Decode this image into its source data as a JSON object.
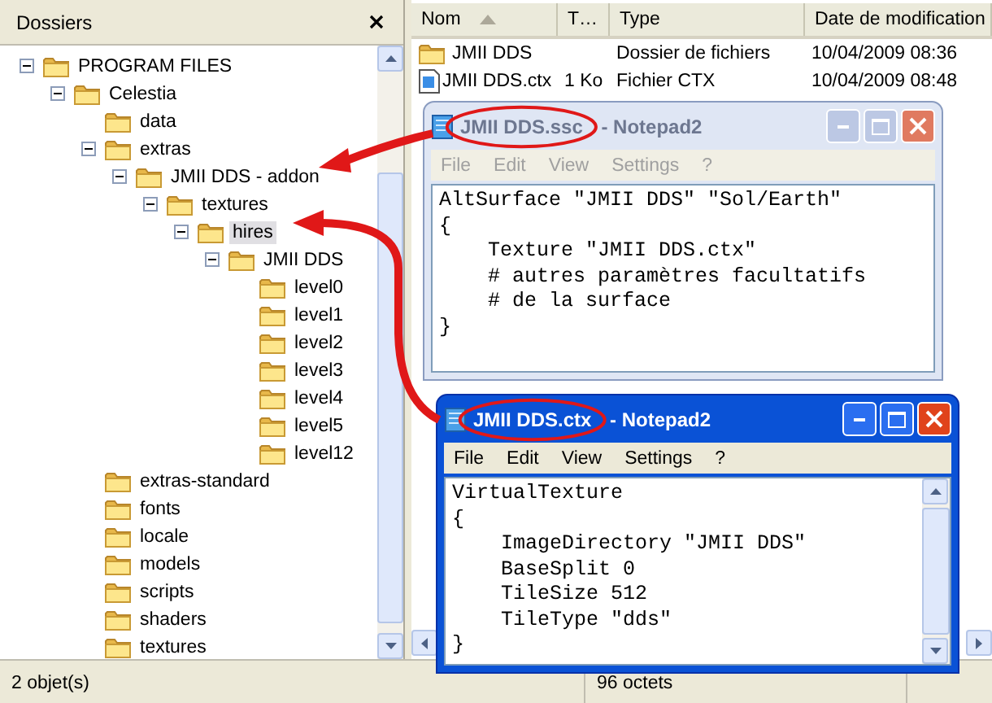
{
  "folders_pane": {
    "title": "Dossiers",
    "tree": [
      {
        "label": "PROGRAM FILES",
        "expanded": true,
        "selected": false,
        "children": [
          {
            "label": "Celestia",
            "expanded": true,
            "selected": false,
            "children": [
              {
                "label": "data",
                "expanded": false,
                "selected": false
              },
              {
                "label": "extras",
                "expanded": true,
                "selected": false,
                "children": [
                  {
                    "label": "JMII DDS - addon",
                    "expanded": true,
                    "selected": false,
                    "children": [
                      {
                        "label": "textures",
                        "expanded": true,
                        "selected": false,
                        "children": [
                          {
                            "label": "hires",
                            "expanded": true,
                            "selected": true,
                            "children": [
                              {
                                "label": "JMII DDS",
                                "expanded": true,
                                "selected": false,
                                "children": [
                                  {
                                    "label": "level0",
                                    "expanded": false,
                                    "selected": false
                                  },
                                  {
                                    "label": "level1",
                                    "expanded": false,
                                    "selected": false
                                  },
                                  {
                                    "label": "level2",
                                    "expanded": false,
                                    "selected": false
                                  },
                                  {
                                    "label": "level3",
                                    "expanded": false,
                                    "selected": false
                                  },
                                  {
                                    "label": "level4",
                                    "expanded": false,
                                    "selected": false
                                  },
                                  {
                                    "label": "level5",
                                    "expanded": false,
                                    "selected": false
                                  },
                                  {
                                    "label": "level12",
                                    "expanded": false,
                                    "selected": false
                                  }
                                ]
                              }
                            ]
                          }
                        ]
                      }
                    ]
                  }
                ]
              },
              {
                "label": "extras-standard",
                "expanded": false,
                "selected": false
              },
              {
                "label": "fonts",
                "expanded": false,
                "selected": false
              },
              {
                "label": "locale",
                "expanded": false,
                "selected": false
              },
              {
                "label": "models",
                "expanded": false,
                "selected": false
              },
              {
                "label": "scripts",
                "expanded": false,
                "selected": false
              },
              {
                "label": "shaders",
                "expanded": false,
                "selected": false
              },
              {
                "label": "textures",
                "expanded": false,
                "selected": false
              }
            ]
          }
        ]
      }
    ]
  },
  "file_list": {
    "columns": [
      "Nom",
      "T…",
      "Type",
      "Date de modification"
    ],
    "rows": [
      {
        "kind": "folder",
        "cells": [
          "JMII DDS",
          "",
          "Dossier de fichiers",
          "10/04/2009 08:36"
        ]
      },
      {
        "kind": "file",
        "cells": [
          "JMII DDS.ctx",
          "1 Ko",
          "Fichier CTX",
          "10/04/2009 08:48"
        ]
      }
    ]
  },
  "windows": [
    {
      "title_file": "JMII DDS.ssc",
      "title_rest": " - Notepad2",
      "active": false,
      "circled": true,
      "scrollbar": false,
      "menu": [
        "File",
        "Edit",
        "View",
        "Settings",
        "?"
      ],
      "lines": [
        "AltSurface \"JMII DDS\" \"Sol/Earth\"",
        "{",
        "    Texture \"JMII DDS.ctx\"",
        "    # autres paramètres facultatifs",
        "    # de la surface",
        "}"
      ]
    },
    {
      "title_file": "JMII DDS.ctx",
      "title_rest": " - Notepad2",
      "active": true,
      "circled": true,
      "scrollbar": true,
      "menu": [
        "File",
        "Edit",
        "View",
        "Settings",
        "?"
      ],
      "lines": [
        "VirtualTexture",
        "{",
        "    ImageDirectory \"JMII DDS\"",
        "    BaseSplit 0",
        "    TileSize 512",
        "    TileType \"dds\"",
        "}"
      ]
    }
  ],
  "status_bar": [
    "2 objet(s)",
    "96 octets"
  ]
}
